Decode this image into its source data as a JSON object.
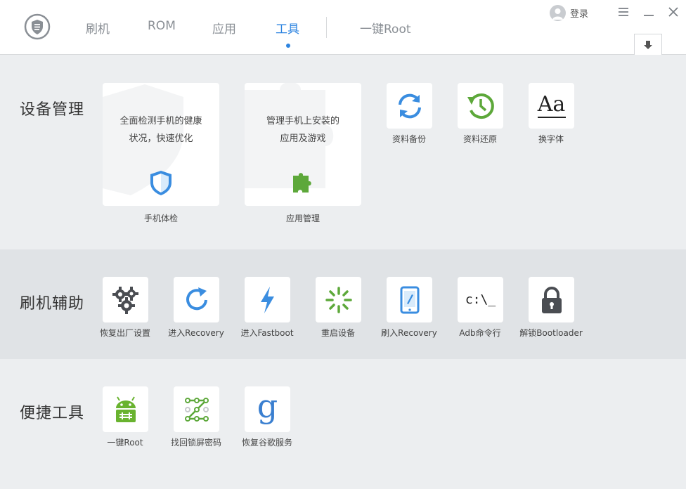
{
  "header": {
    "tabs": [
      "刷机",
      "ROM",
      "应用",
      "工具"
    ],
    "root_tab": "一键Root",
    "login_label": "登录",
    "accent": "#2d84e0"
  },
  "sections": {
    "device": {
      "title": "设备管理",
      "health_card": {
        "desc": "全面检测手机的健康\n状况，快速优化",
        "label": "手机体检",
        "icon": "shield-icon"
      },
      "app_card": {
        "desc": "管理手机上安装的\n应用及游戏",
        "label": "应用管理",
        "icon": "puzzle-icon"
      },
      "tools": [
        {
          "label": "资料备份",
          "icon": "sync-icon"
        },
        {
          "label": "资料还原",
          "icon": "restore-clock-icon"
        },
        {
          "label": "换字体",
          "icon": "font-icon",
          "glyph": "Aa"
        }
      ]
    },
    "flash": {
      "title": "刷机辅助",
      "tools": [
        {
          "label": "恢复出厂设置",
          "icon": "gears-icon"
        },
        {
          "label": "进入Recovery",
          "icon": "refresh-icon"
        },
        {
          "label": "进入Fastboot",
          "icon": "lightning-icon"
        },
        {
          "label": "重启设备",
          "icon": "loading-spinner-icon"
        },
        {
          "label": "刷入Recovery",
          "icon": "tablet-pen-icon"
        },
        {
          "label": "Adb命令行",
          "icon": "terminal-icon",
          "glyph": "c:\\_"
        },
        {
          "label": "解锁Bootloader",
          "icon": "lock-icon"
        }
      ]
    },
    "quick": {
      "title": "便捷工具",
      "tools": [
        {
          "label": "一键Root",
          "icon": "android-icon"
        },
        {
          "label": "找回锁屏密码",
          "icon": "pattern-lock-icon"
        },
        {
          "label": "恢复谷歌服务",
          "icon": "google-icon",
          "glyph": "g"
        }
      ]
    }
  }
}
